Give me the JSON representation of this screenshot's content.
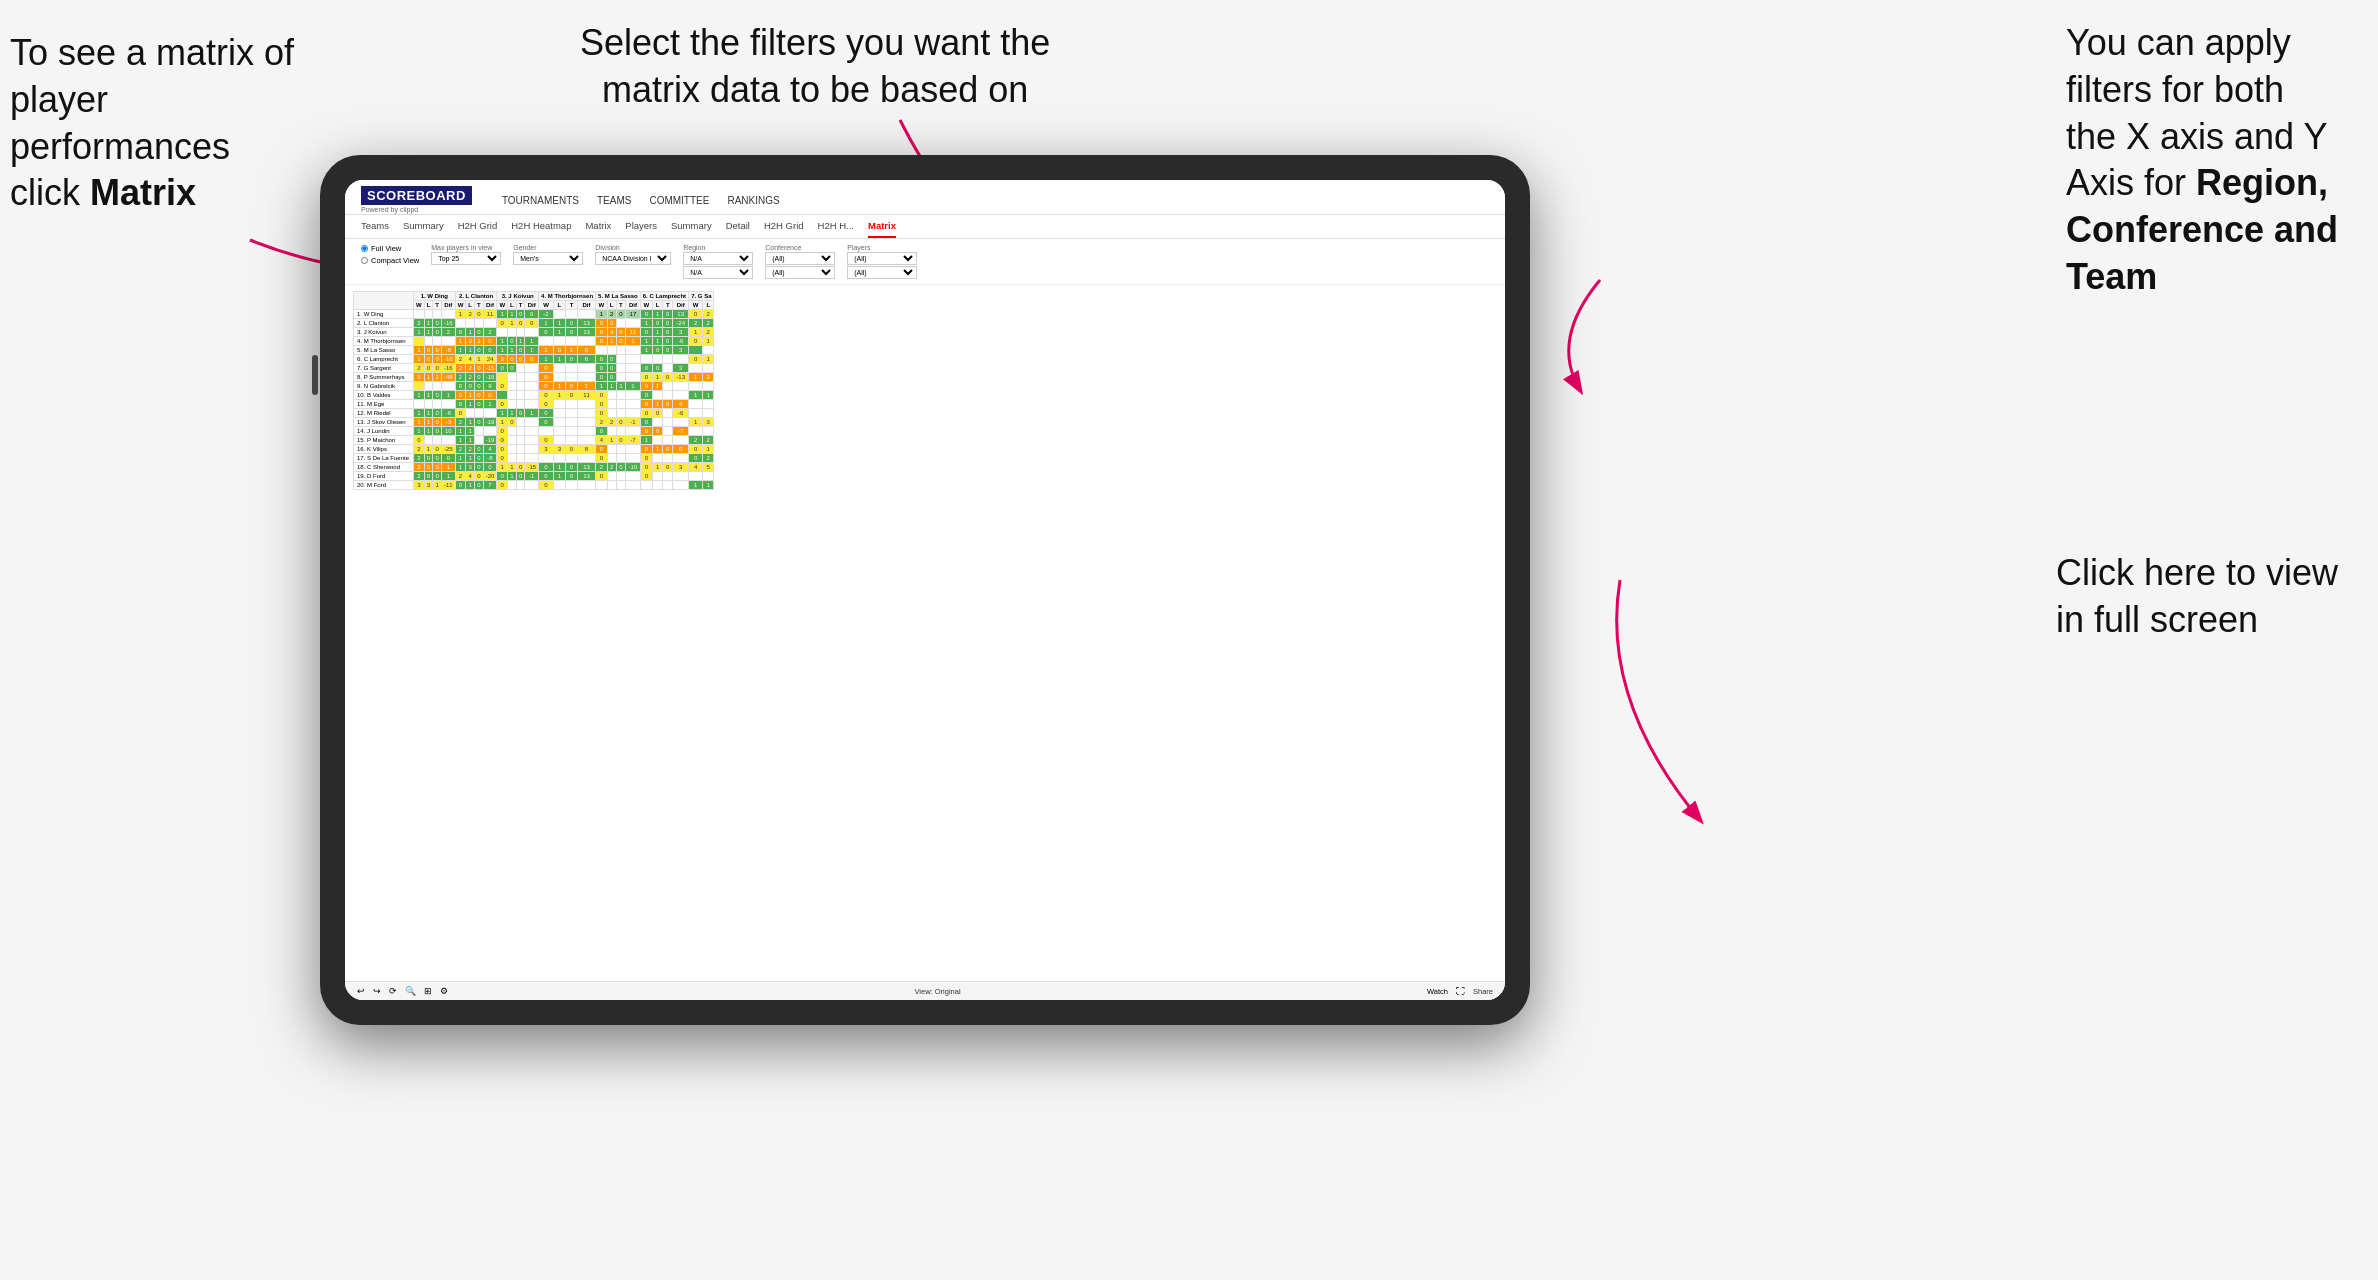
{
  "annotations": {
    "top_left": {
      "line1": "To see a matrix of",
      "line2": "player performances",
      "line3_prefix": "click ",
      "line3_bold": "Matrix"
    },
    "top_center": {
      "text": "Select the filters you want the\nmatrix data to be based on"
    },
    "top_right": {
      "line1": "You  can apply",
      "line2": "filters for both",
      "line3": "the X axis and Y",
      "line4_prefix": "Axis for ",
      "line4_bold": "Region,",
      "line5_bold": "Conference and",
      "line6_bold": "Team"
    },
    "bottom_right": {
      "line1": "Click here to view",
      "line2": "in full screen"
    }
  },
  "scoreboard": {
    "logo_main": "SCOREBOARD",
    "logo_sub": "Powered by clippd",
    "nav_items": [
      "TOURNAMENTS",
      "TEAMS",
      "COMMITTEE",
      "RANKINGS"
    ]
  },
  "sub_nav": {
    "items": [
      "Teams",
      "Summary",
      "H2H Grid",
      "H2H Heatmap",
      "Matrix",
      "Players",
      "Summary",
      "Detail",
      "H2H Grid",
      "H2H H...",
      "Matrix"
    ],
    "active": "Matrix"
  },
  "filters": {
    "view_options": [
      "Full View",
      "Compact View"
    ],
    "max_players_label": "Max players in view",
    "max_players_value": "Top 25",
    "gender_label": "Gender",
    "gender_value": "Men's",
    "division_label": "Division",
    "division_value": "NCAA Division I",
    "region_label": "Region",
    "region_value1": "N/A",
    "region_value2": "N/A",
    "conference_label": "Conference",
    "conference_value1": "(All)",
    "conference_value2": "(All)",
    "players_label": "Players",
    "players_value1": "(All)",
    "players_value2": "(All)"
  },
  "matrix": {
    "column_headers": [
      "1. W Ding",
      "2. L Clanton",
      "3. J Koivun",
      "4. M Thorbjornsen",
      "5. M La Sasso",
      "6. C Lamprecht",
      "7. G Sa"
    ],
    "sub_headers": [
      "W",
      "L",
      "T",
      "Dif"
    ],
    "rows": [
      {
        "name": "1. W Ding",
        "data": "highlight"
      },
      {
        "name": "2. L Clanton",
        "data": "normal"
      },
      {
        "name": "3. J Koivun",
        "data": "normal"
      },
      {
        "name": "4. M Thorbjornsen",
        "data": "normal"
      },
      {
        "name": "5. M La Sasso",
        "data": "normal"
      },
      {
        "name": "6. C Lamprecht",
        "data": "normal"
      },
      {
        "name": "7. G Sargent",
        "data": "normal"
      },
      {
        "name": "8. P Summerhays",
        "data": "normal"
      },
      {
        "name": "9. N Gabrelcik",
        "data": "normal"
      },
      {
        "name": "10. B Valdes",
        "data": "normal"
      },
      {
        "name": "11. M Ege",
        "data": "normal"
      },
      {
        "name": "12. M Riedel",
        "data": "normal"
      },
      {
        "name": "13. J Skov Olesen",
        "data": "normal"
      },
      {
        "name": "14. J Lundin",
        "data": "normal"
      },
      {
        "name": "15. P Maichon",
        "data": "normal"
      },
      {
        "name": "16. K Vilips",
        "data": "normal"
      },
      {
        "name": "17. S De La Fuente",
        "data": "normal"
      },
      {
        "name": "18. C Sherwood",
        "data": "normal"
      },
      {
        "name": "19. D Ford",
        "data": "normal"
      },
      {
        "name": "20. M Ford",
        "data": "normal"
      }
    ]
  },
  "toolbar": {
    "view_label": "View: Original",
    "watch_label": "Watch",
    "share_label": "Share"
  }
}
